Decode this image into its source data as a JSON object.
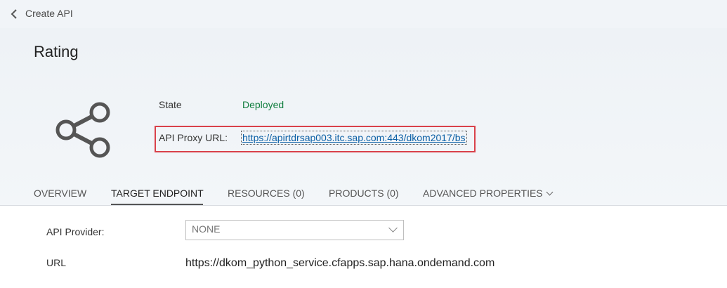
{
  "topbar": {
    "back_icon": "chevron-left-icon",
    "title": "Create API"
  },
  "header": {
    "title": "Rating",
    "icon": "share-icon"
  },
  "info": {
    "state_label": "State",
    "state_value": "Deployed",
    "state_color": "#107e3e",
    "proxy_label": "API Proxy URL:",
    "proxy_url": "https://apirtdrsap003.itc.sap.com:443/dkom2017/bs",
    "highlight_color": "#d9414a"
  },
  "tabs": [
    {
      "label": "OVERVIEW",
      "active": false
    },
    {
      "label": "TARGET ENDPOINT",
      "active": true
    },
    {
      "label": "RESOURCES (0)",
      "active": false
    },
    {
      "label": "PRODUCTS (0)",
      "active": false
    },
    {
      "label": "ADVANCED PROPERTIES",
      "active": false
    }
  ],
  "target": {
    "provider_label": "API Provider:",
    "provider_value": "NONE",
    "url_label": "URL",
    "url_value": "https://dkom_python_service.cfapps.sap.hana.ondemand.com"
  }
}
